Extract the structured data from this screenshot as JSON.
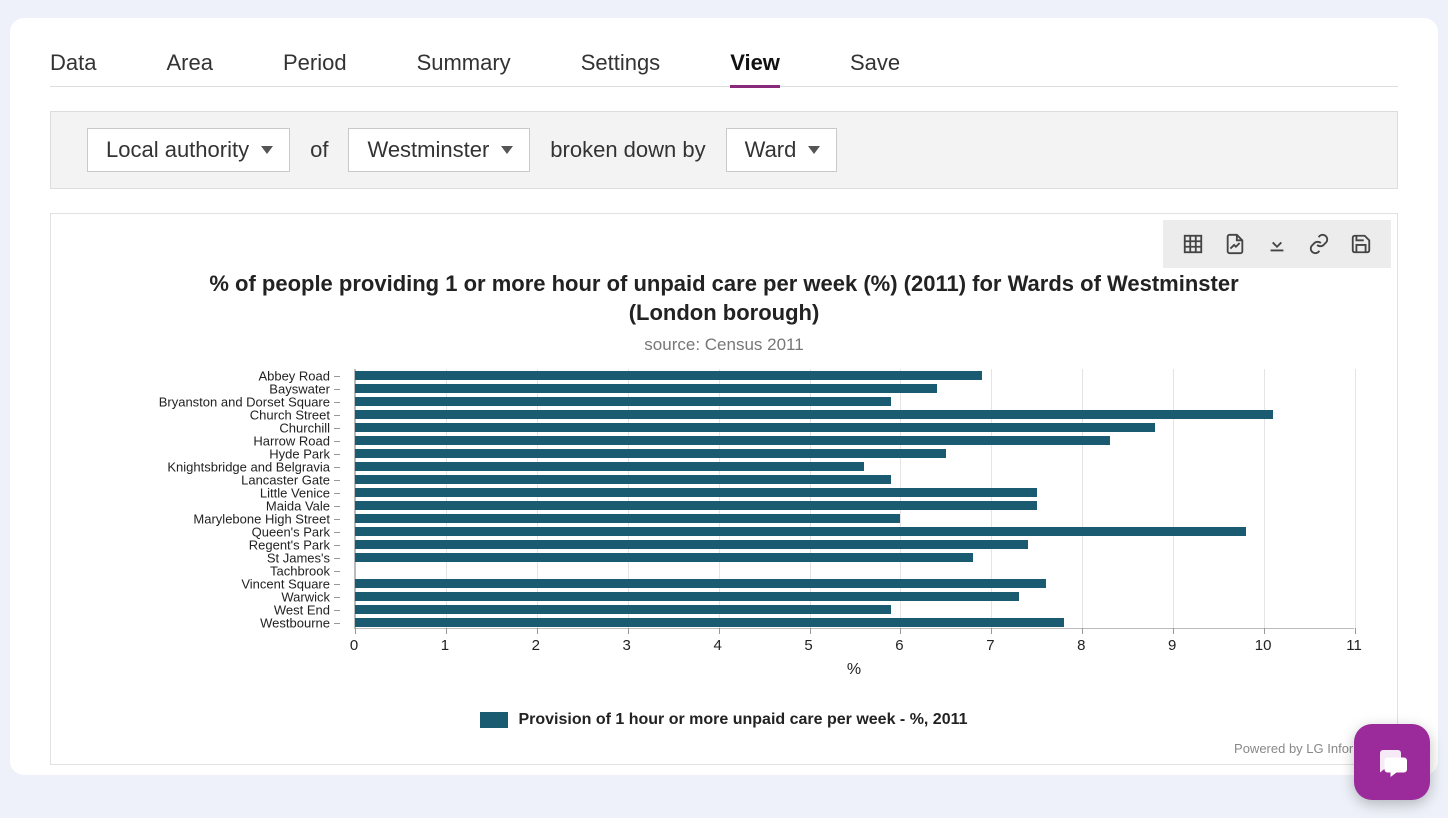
{
  "tabs": {
    "items": [
      "Data",
      "Area",
      "Period",
      "Summary",
      "Settings",
      "View",
      "Save"
    ],
    "active_index": 5
  },
  "filterbar": {
    "level_select": "Local authority",
    "of_text": "of",
    "area_select": "Westminster",
    "breakdown_text": "broken down by",
    "unit_select": "Ward"
  },
  "toolbar_icons": [
    "table-icon",
    "image-export-icon",
    "download-icon",
    "link-icon",
    "save-icon"
  ],
  "chart": {
    "title": "% of people providing 1 or more hour of unpaid care per week (%) (2011) for Wards of Westminster (London borough)",
    "subtitle": "source: Census 2011",
    "x_axis_label": "%",
    "legend_label": "Provision of 1 hour or more unpaid care per week - %, 2011",
    "powered_by": "Powered by LG Inform Plus"
  },
  "chart_data": {
    "type": "bar",
    "orientation": "horizontal",
    "xlabel": "%",
    "ylabel": "",
    "xlim": [
      0,
      11
    ],
    "x_ticks": [
      0,
      1,
      2,
      3,
      4,
      5,
      6,
      7,
      8,
      9,
      10,
      11
    ],
    "title": "% of people providing 1 or more hour of unpaid care per week (%) (2011) for Wards of Westminster (London borough)",
    "source": "Census 2011",
    "series": [
      {
        "name": "Provision of 1 hour or more unpaid care per week - %, 2011",
        "color": "#1a5b71",
        "values": [
          6.9,
          6.4,
          5.9,
          10.1,
          8.8,
          8.3,
          6.5,
          5.6,
          5.9,
          7.5,
          7.5,
          6.0,
          9.8,
          7.4,
          6.8,
          0.0,
          7.6,
          7.3,
          5.9,
          7.8
        ]
      }
    ],
    "categories": [
      "Abbey Road",
      "Bayswater",
      "Bryanston and Dorset Square",
      "Church Street",
      "Churchill",
      "Harrow Road",
      "Hyde Park",
      "Knightsbridge and Belgravia",
      "Lancaster Gate",
      "Little Venice",
      "Maida Vale",
      "Marylebone High Street",
      "Queen's Park",
      "Regent's Park",
      "St James's",
      "Tachbrook",
      "Vincent Square",
      "Warwick",
      "West End",
      "Westbourne"
    ]
  }
}
